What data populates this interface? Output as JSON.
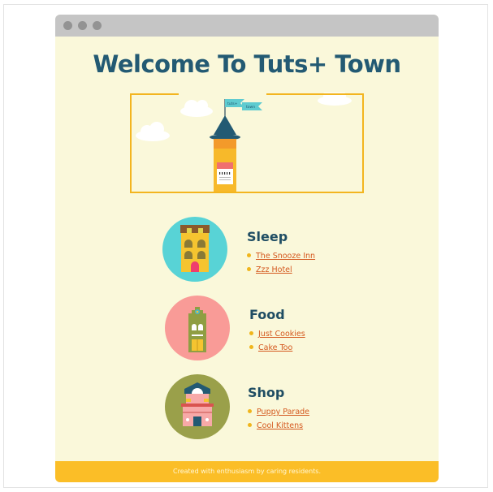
{
  "page": {
    "title": "Welcome To Tuts+ Town",
    "flag_text": [
      "tuts+",
      "town"
    ]
  },
  "sections": [
    {
      "id": "sleep",
      "title": "Sleep",
      "links": [
        "The Snooze Inn",
        "Zzz Hotel"
      ],
      "circle_color": "#58d3d6"
    },
    {
      "id": "food",
      "title": "Food",
      "links": [
        "Just Cookies",
        "Cake Too"
      ],
      "circle_color": "#f99b97"
    },
    {
      "id": "shop",
      "title": "Shop",
      "links": [
        "Puppy Parade",
        "Cool Kittens"
      ],
      "circle_color": "#9aa04a"
    }
  ],
  "footer": {
    "text": "Created with enthusiasm by caring residents."
  },
  "colors": {
    "page_bg": "#faf8da",
    "title": "#235a73",
    "accent_yellow": "#fbbe27",
    "link": "#d4581e",
    "titlebar": "#c5c5c5"
  }
}
